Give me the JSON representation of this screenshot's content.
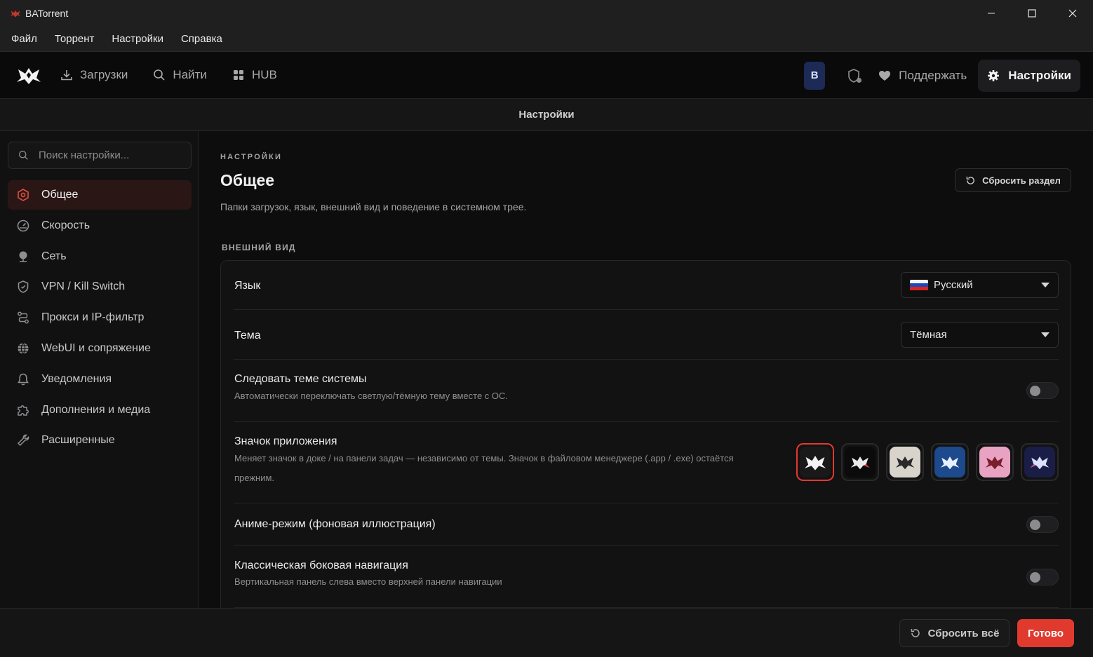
{
  "window": {
    "title": "BATorrent"
  },
  "menu": [
    "Файл",
    "Торрент",
    "Настройки",
    "Справка"
  ],
  "nav": {
    "downloads": "Загрузки",
    "find": "Найти",
    "hub": "HUB",
    "avatar_letter": "B",
    "support": "Поддержать",
    "settings": "Настройки"
  },
  "page_header": "Настройки",
  "sidebar": {
    "search_placeholder": "Поиск настройки...",
    "items": [
      {
        "label": "Общее",
        "icon": "general-icon",
        "active": true
      },
      {
        "label": "Скорость",
        "icon": "speedometer-icon"
      },
      {
        "label": "Сеть",
        "icon": "network-icon"
      },
      {
        "label": "VPN / Kill Switch",
        "icon": "shield-icon"
      },
      {
        "label": "Прокси и IP-фильтр",
        "icon": "route-icon"
      },
      {
        "label": "WebUI и сопряжение",
        "icon": "globe-icon"
      },
      {
        "label": "Уведомления",
        "icon": "bell-icon"
      },
      {
        "label": "Дополнения и медиа",
        "icon": "puzzle-icon"
      },
      {
        "label": "Расширенные",
        "icon": "wrench-icon"
      }
    ]
  },
  "content": {
    "eyebrow": "НАСТРОЙКИ",
    "title": "Общее",
    "description": "Папки загрузок, язык, внешний вид и поведение в системном трее.",
    "reset_section": "Сбросить раздел",
    "group_label": "ВНЕШНИЙ ВИД",
    "rows": {
      "language": {
        "label": "Язык",
        "value": "Русский"
      },
      "theme": {
        "label": "Тема",
        "value": "Тёмная"
      },
      "follow_system": {
        "label": "Следовать теме системы",
        "hint": "Автоматически переключать светлую/тёмную тему вместе с ОС.",
        "enabled": false
      },
      "app_icon": {
        "label": "Значок приложения",
        "hint": "Меняет значок в доке / на панели задач — независимо от темы. Значок в файловом менеджере (.app / .exe) остаётся прежним.",
        "selected_index": 0
      },
      "anime_mode": {
        "label": "Аниме-режим (фоновая иллюстрация)",
        "enabled": false
      },
      "classic_nav": {
        "label": "Классическая боковая навигация",
        "hint": "Вертикальная панель слева вместо верхней панели навигации",
        "enabled": false
      }
    }
  },
  "footer": {
    "reset_all": "Сбросить всё",
    "done": "Готово"
  },
  "colors": {
    "accent": "#e03a2f",
    "background": "#0c0c0d",
    "avatar_bg": "#1c2a55"
  }
}
